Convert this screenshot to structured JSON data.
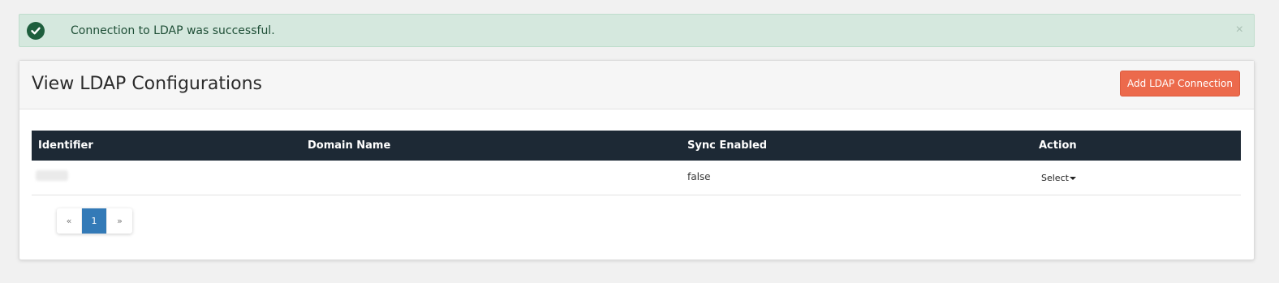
{
  "alert": {
    "message": "Connection to LDAP was successful.",
    "close_label": "×",
    "icon": "check-circle-icon",
    "color": "#d5e8de"
  },
  "panel": {
    "title": "View LDAP Configurations",
    "add_button_label": "Add LDAP Connection",
    "add_button_color": "#ec6a4c"
  },
  "table": {
    "header_color": "#1d2935",
    "columns": [
      "Identifier",
      "Domain Name",
      "Sync Enabled",
      "Action"
    ],
    "rows": [
      {
        "identifier": "",
        "domain_name": "",
        "sync_enabled": "false",
        "action_label": "Select"
      }
    ]
  },
  "pagination": {
    "prev_label": "«",
    "pages": [
      "1"
    ],
    "active_page": "1",
    "next_label": "»",
    "active_color": "#337ab7"
  }
}
